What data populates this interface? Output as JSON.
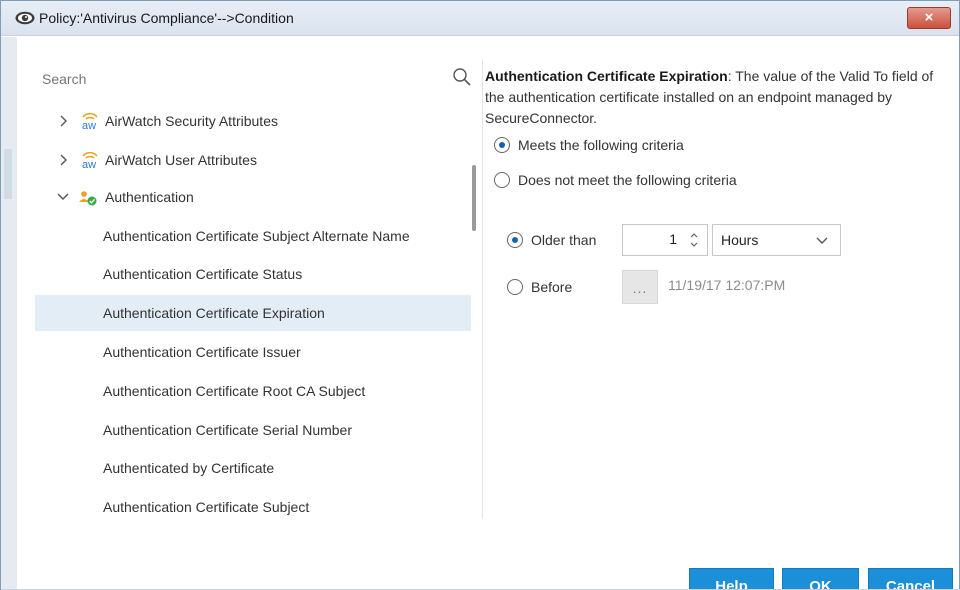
{
  "window": {
    "title": "Policy:'Antivirus Compliance'-->Condition",
    "close_label": "×"
  },
  "search": {
    "placeholder": "Search"
  },
  "tree": {
    "items": [
      {
        "label": "AirWatch Security Attributes",
        "expander": "collapsed",
        "icon": "airwatch-icon"
      },
      {
        "label": "AirWatch User Attributes",
        "expander": "collapsed",
        "icon": "airwatch-icon"
      },
      {
        "label": "Authentication",
        "expander": "expanded",
        "icon": "authentication-users-icon"
      },
      {
        "label": "Authentication Certificate Subject Alternate Name"
      },
      {
        "label": "Authentication Certificate Status"
      },
      {
        "label": "Authentication Certificate Expiration",
        "selected": true
      },
      {
        "label": "Authentication Certificate Issuer"
      },
      {
        "label": "Authentication Certificate Root CA Subject"
      },
      {
        "label": "Authentication Certificate Serial Number"
      },
      {
        "label": "Authenticated by Certificate"
      },
      {
        "label": "Authentication Certificate Subject"
      }
    ]
  },
  "description": {
    "heading": "Authentication Certificate Expiration",
    "text": ": The value of the Valid To field of the authentication certificate installed on an endpoint managed by SecureConnector."
  },
  "criteria": {
    "meets_label": "Meets the following criteria",
    "meets_selected": true,
    "not_meets_label": "Does not meet the following criteria",
    "not_meets_selected": false
  },
  "time": {
    "older_than_label": "Older than",
    "older_than_selected": true,
    "value": "1",
    "unit": "Hours",
    "before_label": "Before",
    "before_selected": false,
    "date_button_label": "...",
    "date_value": "11/19/17 12:07:PM"
  },
  "footer": {
    "help_first": "H",
    "help_rest": "elp",
    "ok_label": "OK",
    "cancel_label": "Cancel"
  },
  "colors": {
    "accent": "#1b8fd8",
    "selected_row": "#e3edf6",
    "close": "#c9503c",
    "airwatch_orange": "#f0a020",
    "airwatch_blue": "#2b7bd6",
    "auth_green": "#3aa845"
  }
}
